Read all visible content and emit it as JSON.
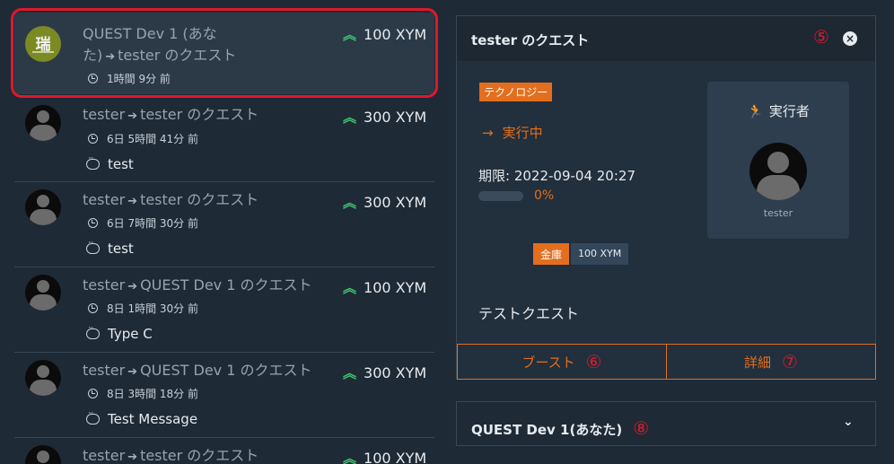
{
  "feed": [
    {
      "from": "QUEST Dev 1 (あなた)",
      "to": "tester のクエスト",
      "amount": "100 XYM",
      "time": "1時間 9分 前",
      "comment": ""
    },
    {
      "from": "tester",
      "to": "tester のクエスト",
      "amount": "300 XYM",
      "time": "6日 5時間 41分 前",
      "comment": "test"
    },
    {
      "from": "tester",
      "to": "tester のクエスト",
      "amount": "300 XYM",
      "time": "6日 7時間 30分 前",
      "comment": "test"
    },
    {
      "from": "tester",
      "to": "QUEST Dev 1 のクエスト",
      "amount": "100 XYM",
      "time": "8日 1時間 30分 前",
      "comment": "Type C"
    },
    {
      "from": "tester",
      "to": "QUEST Dev 1 のクエスト",
      "amount": "300 XYM",
      "time": "8日 3時間 18分 前",
      "comment": "Test Message"
    },
    {
      "from": "tester",
      "to": "tester のクエスト",
      "amount": "100 XYM",
      "time": "",
      "comment": ""
    }
  ],
  "icons": {
    "arrow": "→",
    "boost_up": "⌃",
    "clock": "clock-icon",
    "comment": "comment-icon"
  },
  "detail": {
    "title": "tester のクエスト",
    "annot_close": "⑤",
    "close_glyph": "×",
    "tag": "テクノロジー",
    "status_arrow": "→",
    "status": "実行中",
    "deadline": "期限: 2022-09-04 20:27",
    "progress_pct": 0,
    "progress_label": "0%",
    "vault_label": "金庫",
    "vault_value": "100 XYM",
    "description": "テストクエスト",
    "executor_title": "実行者",
    "executor_icon": "🏃",
    "executor_name": "tester",
    "boost_label": "ブースト",
    "boost_annot": "⑥",
    "detail_label": "詳細",
    "detail_annot": "⑦"
  },
  "accordion": {
    "title": "QUEST Dev 1(あなた)",
    "annot": "⑧",
    "chevron": "⌄"
  },
  "colors": {
    "accent": "#e36f1e",
    "annotation": "#e0182a",
    "bg": "#1e2a36",
    "up": "#3ec26c"
  }
}
